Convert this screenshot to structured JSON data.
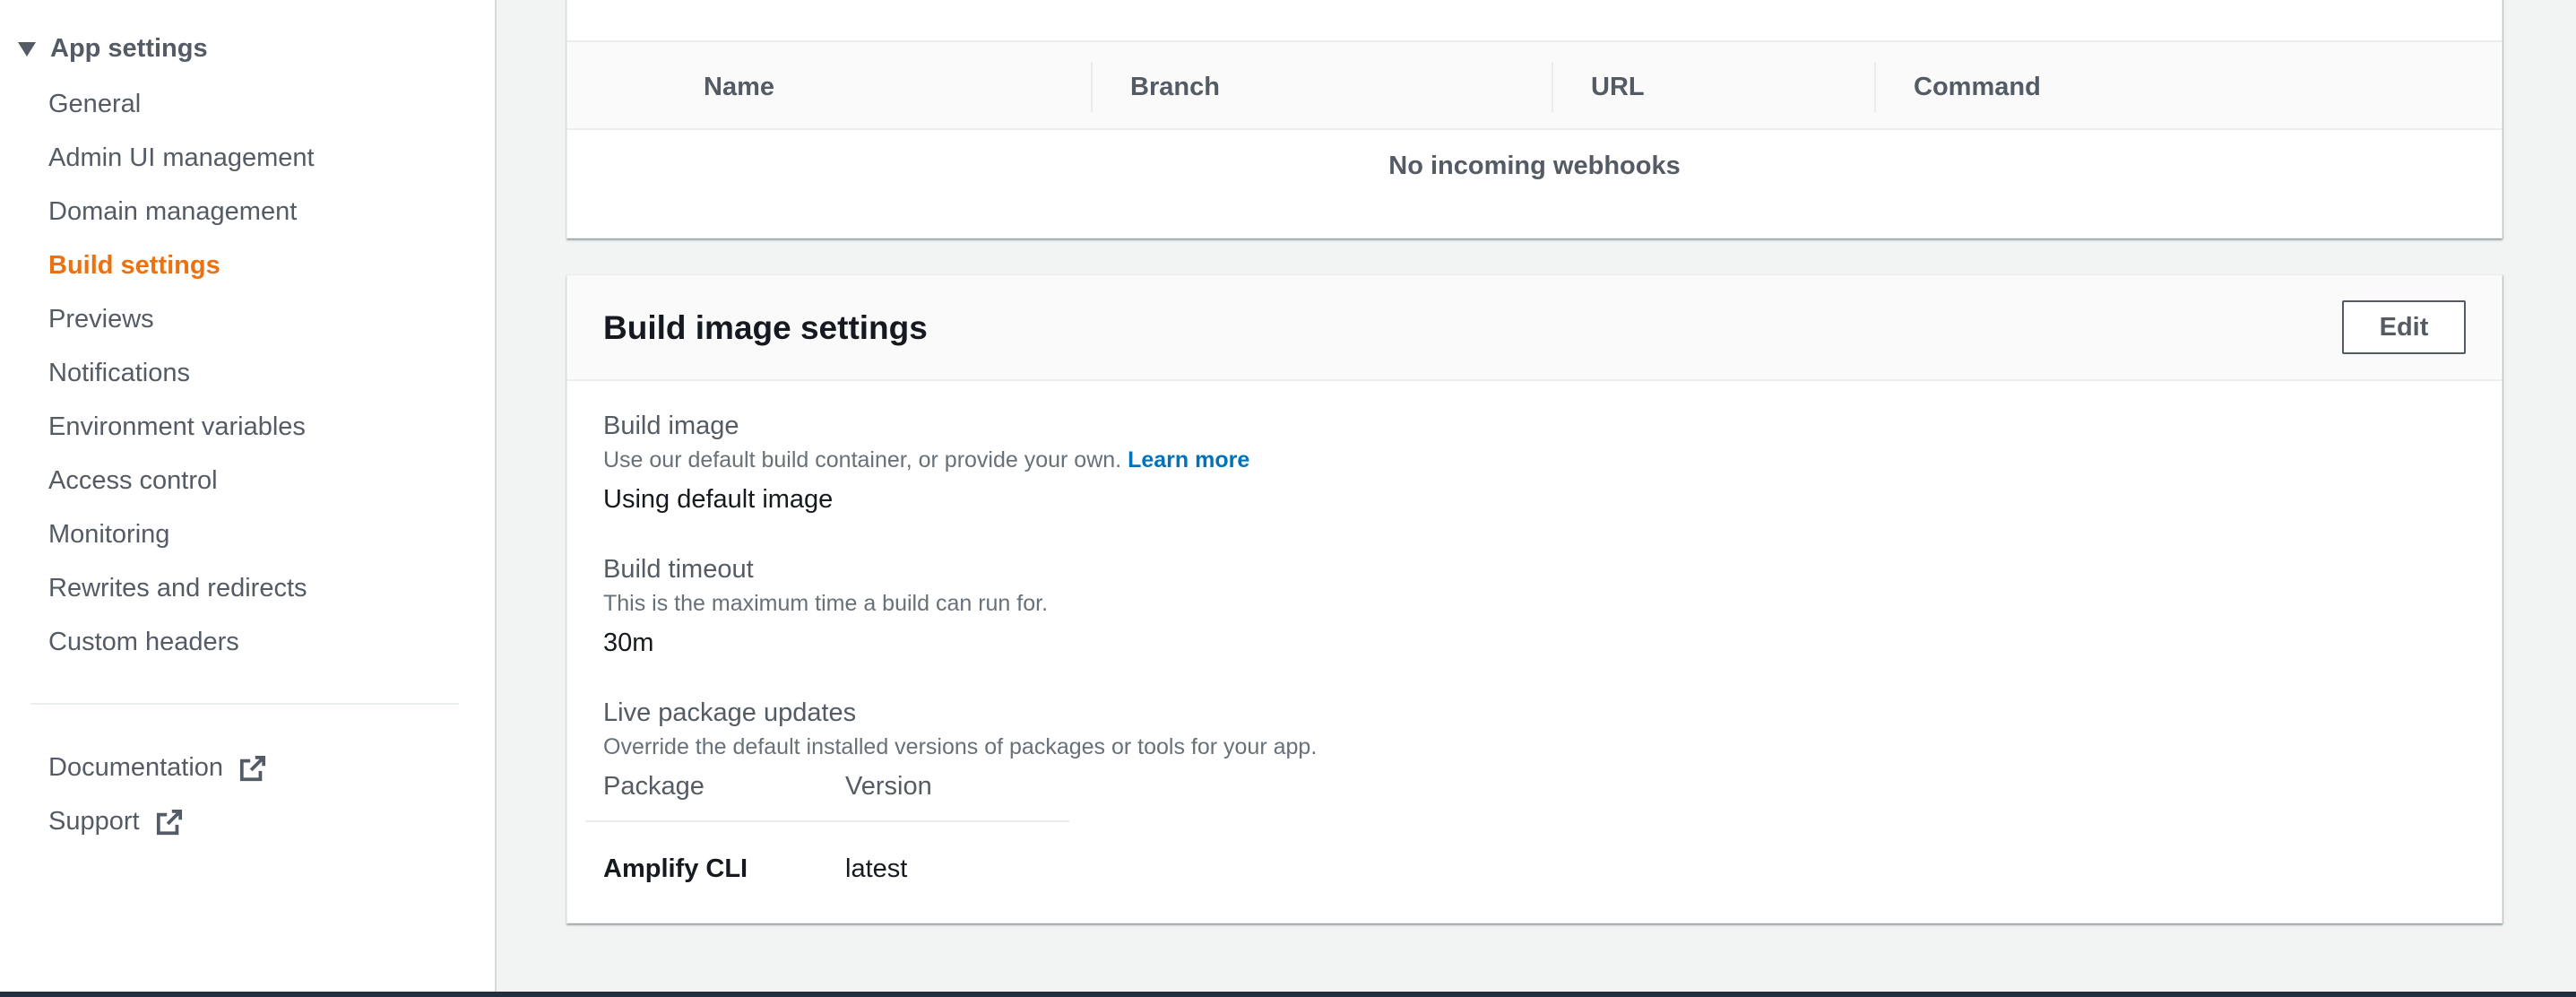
{
  "sidebar": {
    "section_title": "App settings",
    "items": [
      {
        "label": "General"
      },
      {
        "label": "Admin UI management"
      },
      {
        "label": "Domain management"
      },
      {
        "label": "Build settings",
        "active": true
      },
      {
        "label": "Previews"
      },
      {
        "label": "Notifications"
      },
      {
        "label": "Environment variables"
      },
      {
        "label": "Access control"
      },
      {
        "label": "Monitoring"
      },
      {
        "label": "Rewrites and redirects"
      },
      {
        "label": "Custom headers"
      }
    ],
    "links": [
      {
        "label": "Documentation",
        "icon": "external-link-icon"
      },
      {
        "label": "Support",
        "icon": "external-link-icon"
      }
    ]
  },
  "webhooks": {
    "columns": [
      "Name",
      "Branch",
      "URL",
      "Command"
    ],
    "empty_text": "No incoming webhooks"
  },
  "build_image_settings": {
    "title": "Build image settings",
    "edit_label": "Edit",
    "build_image": {
      "label": "Build image",
      "description": "Use our default build container, or provide your own.",
      "link": "Learn more",
      "value": "Using default image"
    },
    "build_timeout": {
      "label": "Build timeout",
      "description": "This is the maximum time a build can run for.",
      "value": "30m"
    },
    "live_package_updates": {
      "label": "Live package updates",
      "description": "Override the default installed versions of packages or tools for your app.",
      "columns": [
        "Package",
        "Version"
      ],
      "rows": [
        {
          "package": "Amplify CLI",
          "version": "latest"
        }
      ]
    }
  },
  "colors": {
    "accent": "#ec7211",
    "link": "#0073bb",
    "text_secondary": "#545b64",
    "background": "#f2f3f3"
  }
}
